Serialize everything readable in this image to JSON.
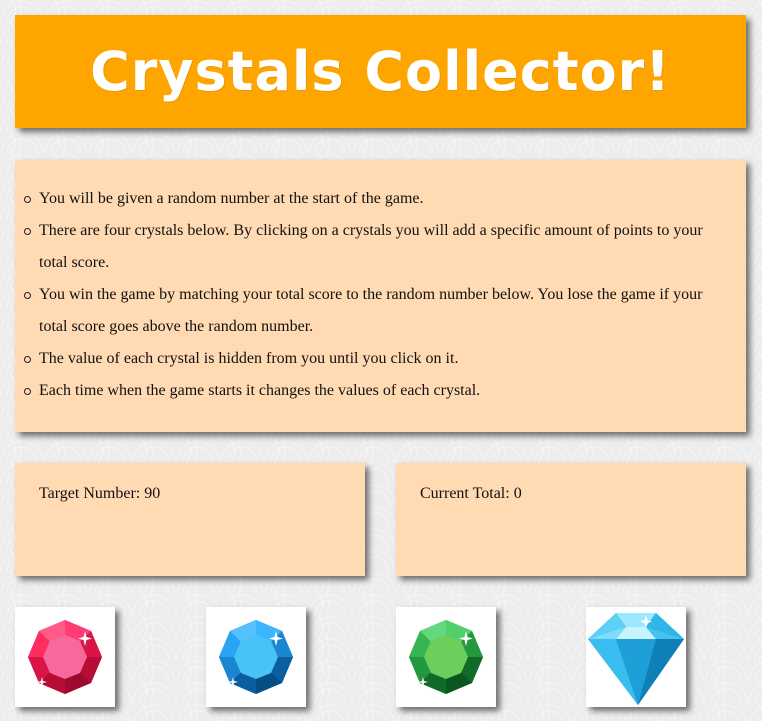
{
  "header": {
    "title": "Crystals Collector!"
  },
  "instructions": {
    "items": [
      "You will be given a random number at the start of the game.",
      "There are four crystals below. By clicking on a crystals you will add a specific amount of points to your total score.",
      "You win the game by matching your total score to the random number below. You lose the game if your total score goes above the random number.",
      "The value of each crystal is hidden from you until you click on it.",
      "Each time when the game starts it changes the values of each crystal."
    ]
  },
  "scores": {
    "target_label": "Target Number:",
    "target_value": "90",
    "total_label": "Current Total:",
    "total_value": "0"
  },
  "crystals": [
    {
      "name": "red-crystal-icon",
      "color": "#e8204f"
    },
    {
      "name": "blue-crystal-icon",
      "color": "#1f8fd8"
    },
    {
      "name": "green-crystal-icon",
      "color": "#25a043"
    },
    {
      "name": "diamond-crystal-icon",
      "color": "#31b7e8"
    }
  ],
  "colors": {
    "header_bg": "#ffa500",
    "panel_bg": "#ffdab2",
    "page_bg": "#ededed"
  }
}
